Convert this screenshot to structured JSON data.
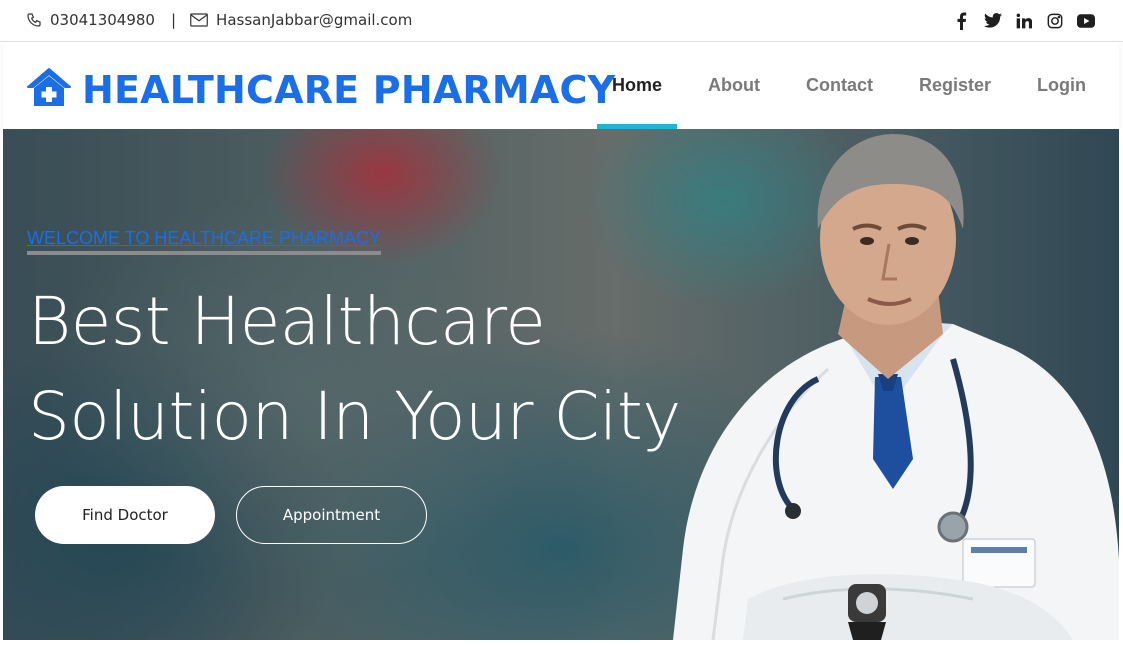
{
  "topbar": {
    "phone": "03041304980",
    "separator": "|",
    "email": "HassanJabbar@gmail.com",
    "social_icons": [
      "facebook-icon",
      "twitter-icon",
      "linkedin-icon",
      "instagram-icon",
      "youtube-icon"
    ]
  },
  "header": {
    "brand": "HEALTHCARE PHARMACY",
    "brand_icon": "house-medical-icon",
    "nav": [
      {
        "label": "Home",
        "active": true
      },
      {
        "label": "About",
        "active": false
      },
      {
        "label": "Contact",
        "active": false
      },
      {
        "label": "Register",
        "active": false
      },
      {
        "label": "Login",
        "active": false
      }
    ]
  },
  "hero": {
    "welcome": "WELCOME TO HEALTHCARE PHARMACY",
    "headline_line1": "Best Healthcare",
    "headline_line2": "Solution In Your City",
    "buttons": {
      "primary": "Find Doctor",
      "secondary": "Appointment"
    }
  },
  "colors": {
    "brand_blue": "#1a6ee8",
    "nav_active_underline": "#1fb3d4",
    "nav_text": "#7a7a7a"
  }
}
